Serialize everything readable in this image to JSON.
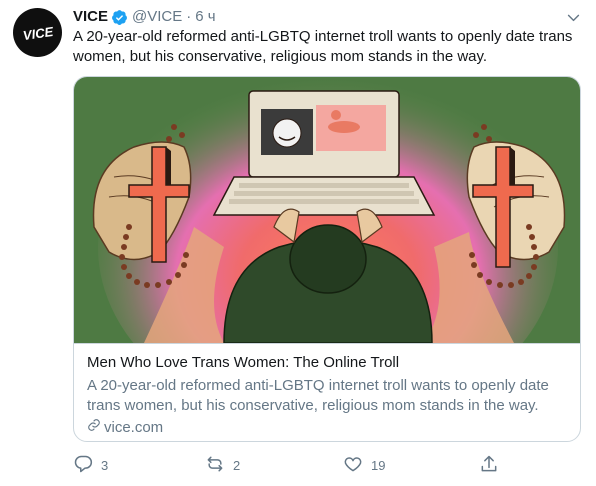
{
  "account": {
    "name": "VICE",
    "handle": "@VICE",
    "separator": "·",
    "time": "6 ч",
    "avatar_text": "VICE"
  },
  "tweet": {
    "text": "A 20-year-old reformed anti-LGBTQ internet troll wants to openly date trans women, but his conservative, religious mom stands in the way."
  },
  "card": {
    "title": "Men Who Love Trans Women: The Online Troll",
    "description": "A 20-year-old reformed anti-LGBTQ internet troll wants to openly date trans women, but his conservative, religious mom stands in the way.",
    "domain": "vice.com",
    "image_subject": "illustration of a person at a laptop between two hands holding rosaries with crosses"
  },
  "actions": {
    "replies": "3",
    "retweets": "2",
    "likes": "19"
  },
  "icons": {
    "verified": "verified-badge-icon",
    "caret": "chevron-down-icon",
    "reply": "reply-icon",
    "retweet": "retweet-icon",
    "like": "heart-icon",
    "share": "share-icon",
    "link": "link-icon"
  },
  "colors": {
    "accent": "#1da1f2",
    "muted": "#657786",
    "text": "#14171a",
    "border": "#ccd6dd"
  }
}
